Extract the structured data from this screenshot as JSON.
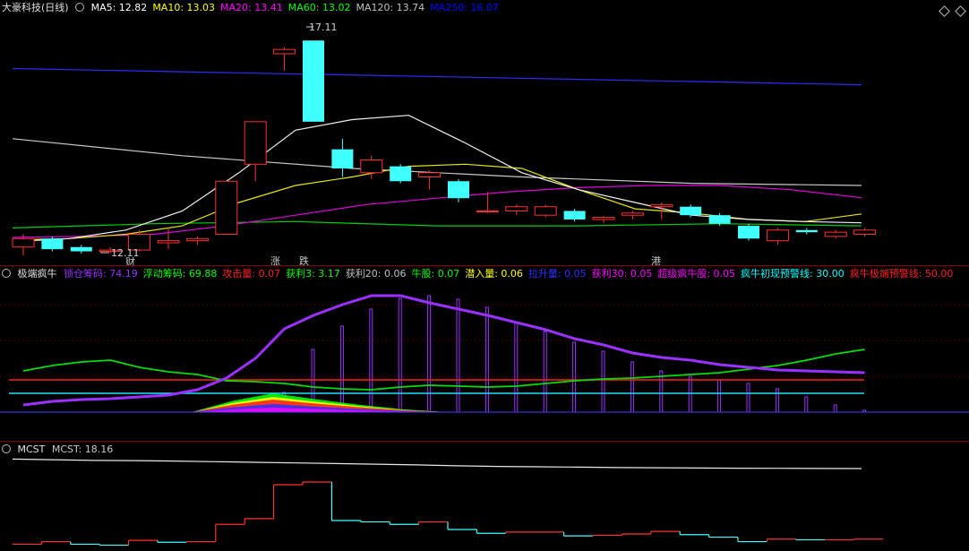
{
  "main": {
    "title": "大豪科技(日线)",
    "indicators": [
      {
        "label": "MA5:",
        "value": "12.82",
        "color": "#ffffff"
      },
      {
        "label": "MA10:",
        "value": "13.03",
        "color": "#ffff00"
      },
      {
        "label": "MA20:",
        "value": "13.41",
        "color": "#ff00ff"
      },
      {
        "label": "MA60:",
        "value": "13.02",
        "color": "#00ff00"
      },
      {
        "label": "MA120:",
        "value": "13.74",
        "color": "#c0c0c0"
      },
      {
        "label": "MA250:",
        "value": "16.07",
        "color": "#0000ff"
      }
    ],
    "high_label": "17.11",
    "low_label": "12.11",
    "markers": [
      {
        "text": "财",
        "color": "#ffffff"
      },
      {
        "text": "涨",
        "color": "#ff4040"
      },
      {
        "text": "跌",
        "color": "#00ff00"
      },
      {
        "text": "港",
        "color": "#00ff00"
      }
    ],
    "candles": [
      {
        "o": 12.25,
        "c": 12.45,
        "h": 12.55,
        "l": 12.05
      },
      {
        "o": 12.45,
        "c": 12.2,
        "h": 12.5,
        "l": 12.15
      },
      {
        "o": 12.25,
        "c": 12.15,
        "h": 12.3,
        "l": 12.1
      },
      {
        "o": 12.15,
        "c": 12.18,
        "h": 12.25,
        "l": 12.11
      },
      {
        "o": 12.18,
        "c": 12.55,
        "h": 12.65,
        "l": 12.15
      },
      {
        "o": 12.35,
        "c": 12.4,
        "h": 12.7,
        "l": 12.2
      },
      {
        "o": 12.4,
        "c": 12.45,
        "h": 12.5,
        "l": 12.3
      },
      {
        "o": 12.55,
        "c": 13.8,
        "h": 13.8,
        "l": 12.55
      },
      {
        "o": 14.2,
        "c": 15.2,
        "h": 15.2,
        "l": 13.8
      },
      {
        "o": 16.8,
        "c": 16.9,
        "h": 16.95,
        "l": 16.4
      },
      {
        "o": 17.11,
        "c": 15.2,
        "h": 17.11,
        "l": 15.2
      },
      {
        "o": 14.55,
        "c": 14.1,
        "h": 14.8,
        "l": 13.9
      },
      {
        "o": 14.0,
        "c": 14.3,
        "h": 14.4,
        "l": 13.85
      },
      {
        "o": 14.15,
        "c": 13.8,
        "h": 14.2,
        "l": 13.75
      },
      {
        "o": 13.9,
        "c": 14.0,
        "h": 14.05,
        "l": 13.6
      },
      {
        "o": 13.8,
        "c": 13.4,
        "h": 13.85,
        "l": 13.3
      },
      {
        "o": 13.1,
        "c": 13.1,
        "h": 13.55,
        "l": 13.05
      },
      {
        "o": 13.1,
        "c": 13.2,
        "h": 13.25,
        "l": 13.0
      },
      {
        "o": 13.0,
        "c": 13.2,
        "h": 13.25,
        "l": 12.95
      },
      {
        "o": 13.1,
        "c": 12.9,
        "h": 13.15,
        "l": 12.85
      },
      {
        "o": 12.9,
        "c": 12.95,
        "h": 12.98,
        "l": 12.82
      },
      {
        "o": 13.0,
        "c": 13.05,
        "h": 13.1,
        "l": 12.9
      },
      {
        "o": 13.2,
        "c": 13.25,
        "h": 13.3,
        "l": 12.9
      },
      {
        "o": 13.2,
        "c": 13.0,
        "h": 13.25,
        "l": 12.95
      },
      {
        "o": 13.0,
        "c": 12.8,
        "h": 13.05,
        "l": 12.75
      },
      {
        "o": 12.75,
        "c": 12.45,
        "h": 12.8,
        "l": 12.4
      },
      {
        "o": 12.4,
        "c": 12.65,
        "h": 12.7,
        "l": 12.3
      },
      {
        "o": 12.65,
        "c": 12.6,
        "h": 12.7,
        "l": 12.55
      },
      {
        "o": 12.5,
        "c": 12.6,
        "h": 12.65,
        "l": 12.45
      },
      {
        "o": 12.55,
        "c": 12.65,
        "h": 12.7,
        "l": 12.5
      }
    ],
    "ma250": [
      16.45,
      16.07
    ],
    "ma120": [
      14.8,
      14.4,
      14.1,
      13.9,
      13.75,
      13.7
    ],
    "ma60": [
      12.7,
      12.8,
      12.85,
      12.75,
      12.75,
      12.8,
      12.75
    ],
    "ma20": [
      12.48,
      12.5,
      12.55,
      12.75,
      13.0,
      13.25,
      13.4,
      13.55,
      13.65,
      13.7,
      13.7,
      13.6,
      13.41
    ],
    "ma10": [
      12.42,
      12.45,
      12.55,
      12.75,
      13.3,
      13.7,
      13.9,
      14.15,
      14.2,
      14.1,
      13.6,
      13.15,
      13.05,
      12.9,
      12.85,
      13.03
    ],
    "ma5": [
      12.38,
      12.45,
      12.65,
      13.1,
      14.0,
      15.0,
      15.25,
      15.35,
      14.7,
      14.0,
      13.6,
      13.3,
      13.0,
      12.9,
      12.85,
      12.82
    ]
  },
  "mid": {
    "title": "极端疯牛",
    "indicators": [
      {
        "label": "锁仓筹码:",
        "value": "74.19",
        "color": "#9b30ff"
      },
      {
        "label": "浮动筹码:",
        "value": "69.88",
        "color": "#00ff00"
      },
      {
        "label": "攻击量:",
        "value": "0.07",
        "color": "#ff2020"
      },
      {
        "label": "获利3:",
        "value": "3.17",
        "color": "#00ff00"
      },
      {
        "label": "获利20:",
        "value": "0.06",
        "color": "#c0c0c0"
      },
      {
        "label": "牛股:",
        "value": "0.07",
        "color": "#00ff00"
      },
      {
        "label": "潜入量:",
        "value": "0.06",
        "color": "#ffff00"
      },
      {
        "label": "拉升量:",
        "value": "0.05",
        "color": "#3030ff"
      },
      {
        "label": "获利30:",
        "value": "0.05",
        "color": "#ff00ff"
      },
      {
        "label": "超级疯牛股:",
        "value": "0.05",
        "color": "#ff00ff"
      },
      {
        "label": "疯牛初现预警线:",
        "value": "30.00",
        "color": "#00ffff"
      },
      {
        "label": "疯牛极端预警线:",
        "value": "50.00",
        "color": "#ff2020"
      }
    ],
    "lock_chip": [
      8,
      12,
      14,
      15,
      17,
      19,
      25,
      38,
      60,
      93,
      108,
      120,
      130,
      130,
      122,
      115,
      108,
      100,
      92,
      82,
      75,
      66,
      61,
      58,
      53,
      50,
      47,
      46,
      45,
      44
    ],
    "float_chip": [
      46,
      52,
      56,
      58,
      50,
      45,
      42,
      35,
      34,
      32,
      28,
      26,
      25,
      28,
      30,
      29,
      28,
      29,
      32,
      35,
      37,
      38,
      40,
      42,
      44,
      48,
      52,
      58,
      65,
      70
    ],
    "bars": [
      0,
      0,
      0,
      0,
      0,
      0,
      0,
      0,
      0,
      22,
      70,
      96,
      115,
      127,
      130,
      126,
      117,
      100,
      90,
      78,
      68,
      56,
      46,
      40,
      36,
      32,
      26,
      17,
      8,
      2
    ]
  },
  "bottom": {
    "title": "MCST",
    "indicators": [
      {
        "label": "MCST:",
        "value": "18.16",
        "color": "#c8c8c8"
      }
    ],
    "mcst_line": [
      18.9,
      18.85,
      18.8,
      18.78,
      18.75,
      18.7,
      18.65,
      18.6,
      18.55,
      18.5,
      18.45,
      18.38,
      18.33,
      18.3,
      18.27,
      18.24,
      18.22,
      18.2,
      18.19,
      18.18,
      18.17,
      18.16
    ],
    "price_step": [
      12.25,
      12.45,
      12.25,
      12.18,
      12.55,
      12.4,
      12.45,
      13.8,
      14.25,
      16.9,
      17.11,
      14.1,
      14.0,
      13.8,
      14.0,
      13.4,
      13.1,
      13.2,
      13.2,
      12.9,
      12.95,
      13.05,
      13.25,
      13.0,
      12.8,
      12.45,
      12.65,
      12.6,
      12.6,
      12.65
    ]
  }
}
